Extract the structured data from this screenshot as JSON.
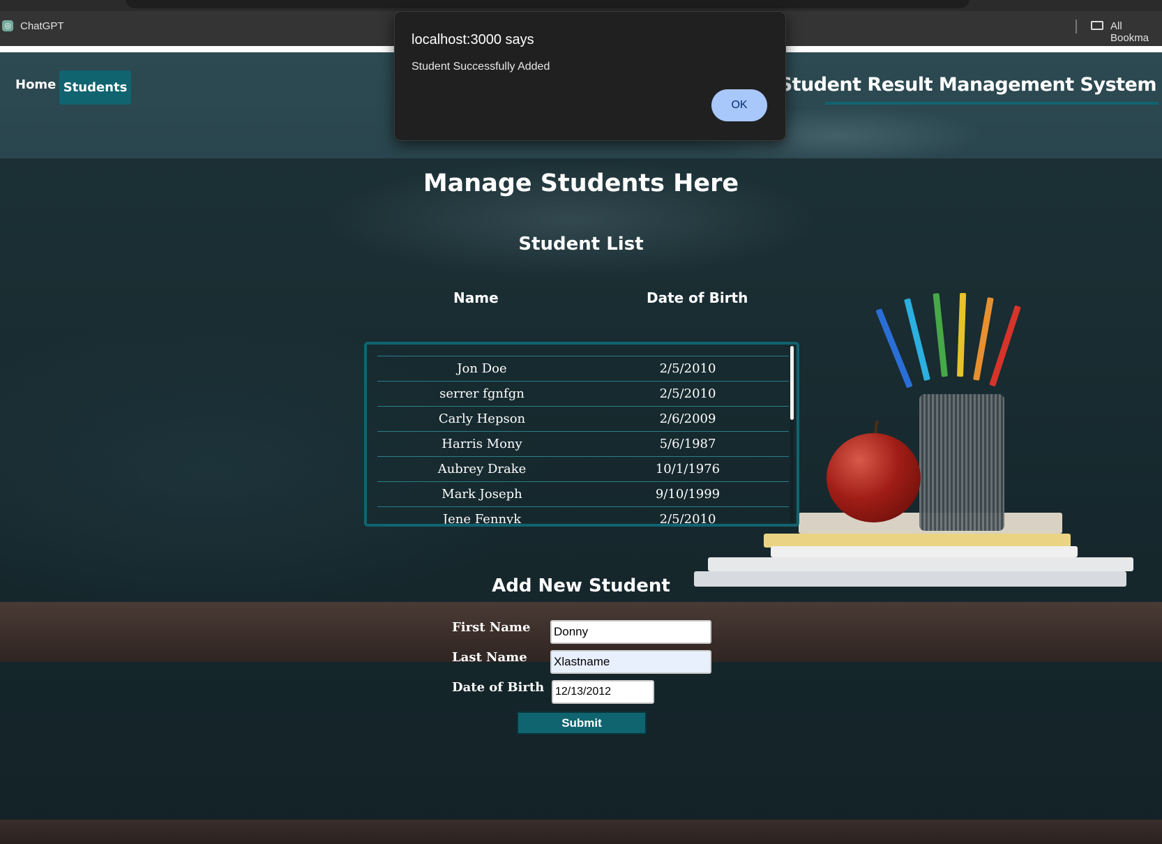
{
  "browser": {
    "bookmarks": [
      {
        "label": "ChatGPT"
      },
      {
        "label": "All Bookma"
      }
    ]
  },
  "nav": {
    "items": [
      {
        "label": "Home"
      },
      {
        "label": "Students"
      }
    ],
    "site_title": "Student Result Management System",
    "accent_color": "#106470"
  },
  "main": {
    "heading": "Manage Students Here",
    "list_heading": "Student List",
    "columns": [
      "Name",
      "Date of Birth"
    ],
    "students": [
      {
        "name": "Jon Doe",
        "dob": "2/5/2010"
      },
      {
        "name": "serrer fgnfgn",
        "dob": "2/5/2010"
      },
      {
        "name": "Carly Hepson",
        "dob": "2/6/2009"
      },
      {
        "name": "Harris Mony",
        "dob": "5/6/1987"
      },
      {
        "name": "Aubrey Drake",
        "dob": "10/1/1976"
      },
      {
        "name": "Mark Joseph",
        "dob": "9/10/1999"
      },
      {
        "name": "Jene Fennyk",
        "dob": "2/5/2010"
      }
    ]
  },
  "form": {
    "heading": "Add New Student",
    "first_name_label": "First Name",
    "first_name_value": "Donny",
    "last_name_label": "Last Name",
    "last_name_value": "Xlastname",
    "dob_label": "Date of Birth",
    "dob_value": "12/13/2012",
    "submit_label": "Submit"
  },
  "dialog": {
    "title": "localhost:3000 says",
    "message": "Student Successfully Added",
    "ok_label": "OK"
  }
}
